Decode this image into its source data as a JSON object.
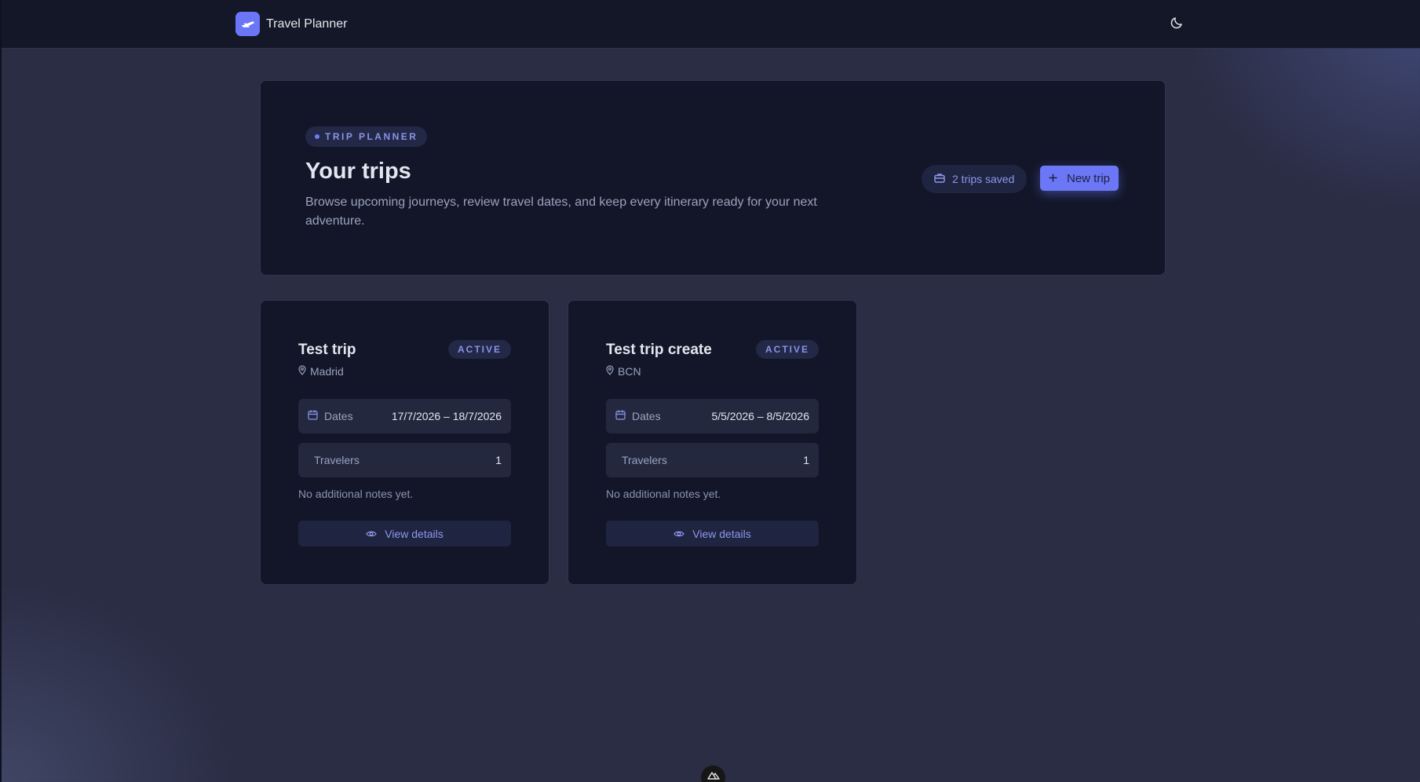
{
  "app": {
    "name": "Travel Planner",
    "logo_icon": "plane-icon",
    "theme_icon": "moon-icon"
  },
  "hero": {
    "tag": "TRIP PLANNER",
    "title": "Your trips",
    "description": "Browse upcoming journeys, review travel dates, and keep every itinerary ready for your next adventure.",
    "saved_count": "2 trips saved",
    "new_trip_label": "New trip"
  },
  "trips": [
    {
      "title": "Test trip",
      "location": "Madrid",
      "status": "ACTIVE",
      "dates_label": "Dates",
      "dates": "17/7/2026 – 18/7/2026",
      "travelers_label": "Travelers",
      "travelers": "1",
      "notes": "No additional notes yet.",
      "view_label": "View details"
    },
    {
      "title": "Test trip create",
      "location": "BCN",
      "status": "ACTIVE",
      "dates_label": "Dates",
      "dates": "5/5/2026 – 8/5/2026",
      "travelers_label": "Travelers",
      "travelers": "1",
      "notes": "No additional notes yet.",
      "view_label": "View details"
    }
  ],
  "colors": {
    "accent": "#6c77f5",
    "background": "#2b2d45",
    "card": "#121628"
  }
}
